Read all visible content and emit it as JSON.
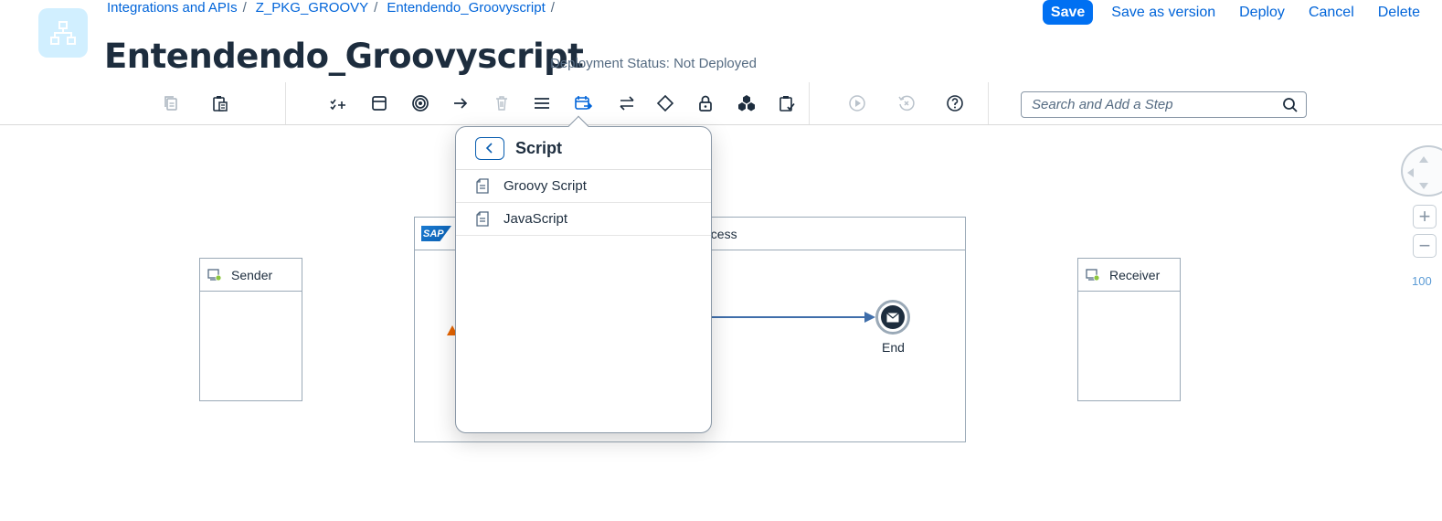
{
  "header": {
    "breadcrumbs": [
      "Integrations and APIs",
      "Z_PKG_GROOVY",
      "Entendendo_Groovyscript"
    ],
    "breadcrumb_separator": "/",
    "title": "Entendendo_Groovyscript",
    "deployment_status": "Deployment Status: Not Deployed",
    "actions": {
      "save": "Save",
      "save_as_version": "Save as version",
      "deploy": "Deploy",
      "cancel": "Cancel",
      "delete": "Delete"
    }
  },
  "toolbar": {
    "search_placeholder": "Search and Add a Step"
  },
  "canvas": {
    "sender_label": "Sender",
    "receiver_label": "Receiver",
    "pool_title": "ocess",
    "sap_logo_text": "SAP",
    "end_label": "End",
    "zoom_plus": "+",
    "zoom_minus": "−",
    "zoom_level": "100"
  },
  "popover": {
    "title": "Script",
    "items": [
      {
        "label": "Groovy Script"
      },
      {
        "label": "JavaScript"
      }
    ]
  },
  "colors": {
    "accent": "#0070f2",
    "link": "#0064d9",
    "text": "#1d2d3e",
    "muted": "#556b82",
    "border": "#9aa9b7",
    "flow": "#3f6eaa",
    "warning": "#e76500"
  }
}
